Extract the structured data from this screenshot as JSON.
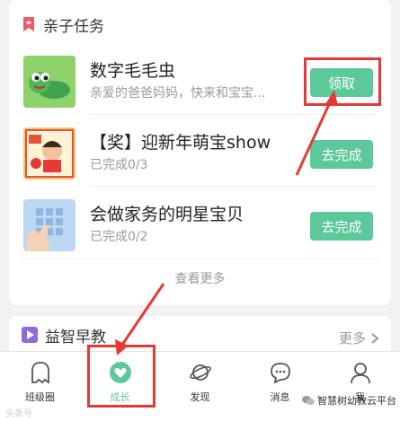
{
  "tasks_section": {
    "title": "亲子任务",
    "tasks": [
      {
        "title": "数字毛毛虫",
        "subtitle": "亲爱的爸爸妈妈，快来和宝宝...",
        "button": "领取"
      },
      {
        "title": "【奖】迎新年萌宝show",
        "subtitle": "已完成0/3",
        "button": "去完成"
      },
      {
        "title": "会做家务的明星宝贝",
        "subtitle": "已完成0/2",
        "button": "去完成"
      }
    ],
    "see_more": "查看更多"
  },
  "edu_section": {
    "title": "益智早教",
    "more": "更多"
  },
  "tabbar": {
    "tabs": [
      {
        "label": "班级圈",
        "icon": "ghost-icon"
      },
      {
        "label": "成长",
        "icon": "heart-icon",
        "active": true
      },
      {
        "label": "发现",
        "icon": "planet-icon"
      },
      {
        "label": "消息",
        "icon": "chat-bubble-icon"
      },
      {
        "label": "我",
        "icon": "person-icon"
      }
    ]
  },
  "watermarks": {
    "left": "头条号",
    "right": "智慧树幼教云平台"
  },
  "colors": {
    "accent_green": "#5cc99a",
    "annotation_red": "#e53935",
    "section_icon_red": "#ef5b6b",
    "section_icon_purple": "#8e6bd8"
  }
}
